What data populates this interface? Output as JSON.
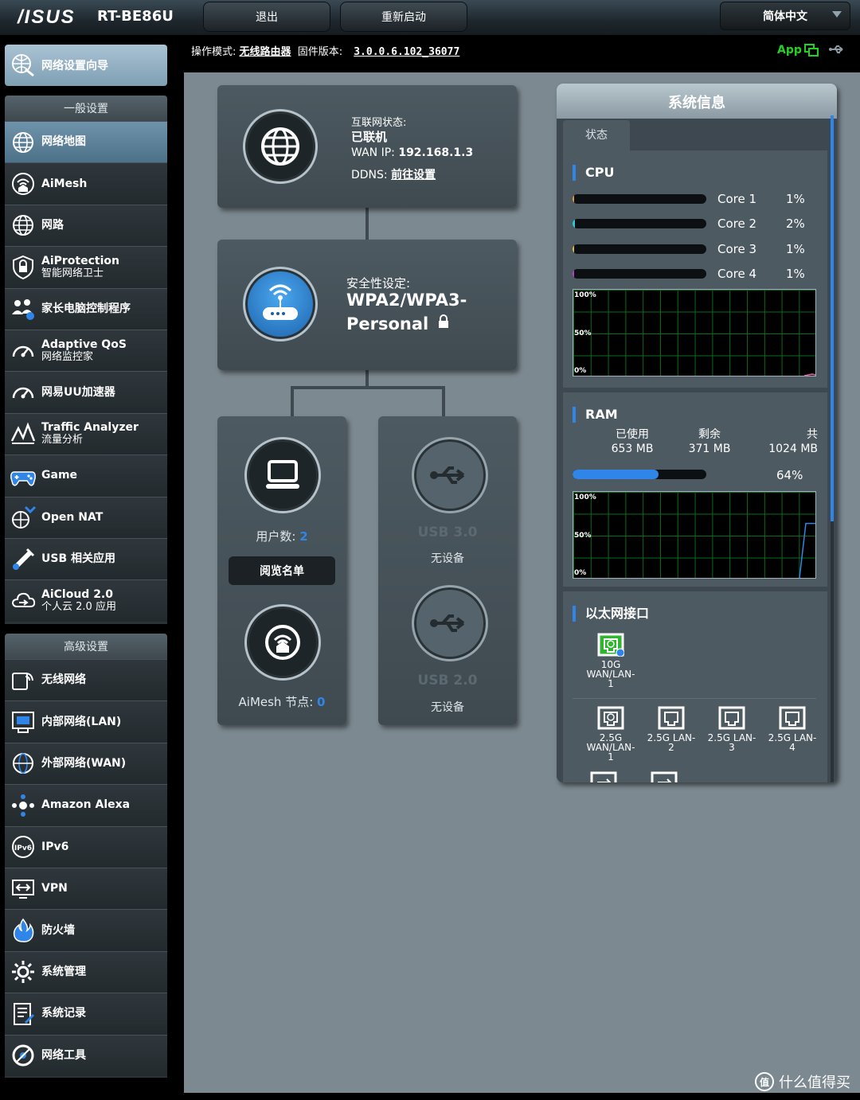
{
  "header": {
    "brand": "/ISUS",
    "model": "RT-BE86U",
    "logout_label": "退出",
    "reboot_label": "重新启动",
    "language": "简体中文"
  },
  "infoline": {
    "mode_label": "操作模式:",
    "mode_value": "无线路由器",
    "fw_label": "固件版本:",
    "fw_value": "3.0.0.6.102_36077",
    "app_label": "App"
  },
  "sidebar": {
    "wizard_label": "网络设置向导",
    "general_title": "一般设置",
    "general_items": [
      {
        "label": "网络地图",
        "sub": ""
      },
      {
        "label": "AiMesh",
        "sub": ""
      },
      {
        "label": "网路",
        "sub": ""
      },
      {
        "label": "AiProtection",
        "sub": "智能网络卫士"
      },
      {
        "label": "家长电脑控制程序",
        "sub": ""
      },
      {
        "label": "Adaptive QoS",
        "sub": "网络监控家"
      },
      {
        "label": "网易UU加速器",
        "sub": ""
      },
      {
        "label": "Traffic Analyzer",
        "sub": "流量分析"
      },
      {
        "label": "Game",
        "sub": ""
      },
      {
        "label": "Open NAT",
        "sub": ""
      },
      {
        "label": "USB 相关应用",
        "sub": ""
      },
      {
        "label": "AiCloud 2.0",
        "sub": "个人云 2.0 应用"
      }
    ],
    "advanced_title": "高级设置",
    "advanced_items": [
      {
        "label": "无线网络",
        "sub": ""
      },
      {
        "label": "内部网络(LAN)",
        "sub": ""
      },
      {
        "label": "外部网络(WAN)",
        "sub": ""
      },
      {
        "label": "Amazon Alexa",
        "sub": ""
      },
      {
        "label": "IPv6",
        "sub": ""
      },
      {
        "label": "VPN",
        "sub": ""
      },
      {
        "label": "防火墙",
        "sub": ""
      },
      {
        "label": "系统管理",
        "sub": ""
      },
      {
        "label": "系统记录",
        "sub": ""
      },
      {
        "label": "网络工具",
        "sub": ""
      }
    ]
  },
  "internet": {
    "status_label": "互联网状态:",
    "status_value": "已联机",
    "wan_ip_label": "WAN IP:",
    "wan_ip_value": "192.168.1.3",
    "ddns_label": "DDNS:",
    "ddns_link": "前往设置"
  },
  "security": {
    "label": "安全性设定:",
    "value_line1": "WPA2/WPA3-",
    "value_line2": "Personal"
  },
  "clients": {
    "count_label": "用户数:",
    "count_value": "2",
    "view_list_label": "阅览名单",
    "aimesh_label": "AiMesh 节点:",
    "aimesh_value": "0"
  },
  "usb": {
    "usb3_label": "USB 3.0",
    "usb3_status": "无设备",
    "usb2_label": "USB 2.0",
    "usb2_status": "无设备"
  },
  "sysinfo": {
    "title": "系统信息",
    "tab_status": "状态",
    "cpu_title": "CPU",
    "cores": [
      {
        "name": "Core 1",
        "pct": "1%",
        "value": 0.01,
        "color": "#e8a030"
      },
      {
        "name": "Core 2",
        "pct": "2%",
        "value": 0.02,
        "color": "#30c8d8"
      },
      {
        "name": "Core 3",
        "pct": "1%",
        "value": 0.01,
        "color": "#e8c030"
      },
      {
        "name": "Core 4",
        "pct": "1%",
        "value": 0.01,
        "color": "#c040d0"
      }
    ],
    "graph_labels": {
      "top": "100%",
      "mid": "50%",
      "bottom": "0%"
    },
    "ram_title": "RAM",
    "ram_used_label": "已使用",
    "ram_used_value": "653 MB",
    "ram_free_label": "剩余",
    "ram_free_value": "371 MB",
    "ram_total_label": "共",
    "ram_total_value": "1024 MB",
    "ram_pct": "64%",
    "ram_fraction": 0.64,
    "ethernet_title": "以太网接口",
    "ports": [
      {
        "label": "10G WAN/LAN-1",
        "line1": "10G",
        "line2": "WAN/LAN-",
        "line3": "1",
        "active": true
      },
      {
        "label": "2.5G WAN/LAN-1",
        "line1": "2.5G",
        "line2": "WAN/LAN-",
        "line3": "1",
        "active": false
      },
      {
        "label": "2.5G LAN-2",
        "line1": "2.5G LAN-",
        "line2": "2",
        "line3": "",
        "active": false
      },
      {
        "label": "2.5G LAN-3",
        "line1": "2.5G LAN-",
        "line2": "3",
        "line3": "",
        "active": false
      },
      {
        "label": "2.5G LAN-4",
        "line1": "2.5G LAN-",
        "line2": "4",
        "line3": "",
        "active": false
      }
    ]
  },
  "watermark": "什么值得买",
  "colors": {
    "accent": "#2f86e8",
    "active_port": "#2fb52f",
    "app_green": "#21d321"
  }
}
